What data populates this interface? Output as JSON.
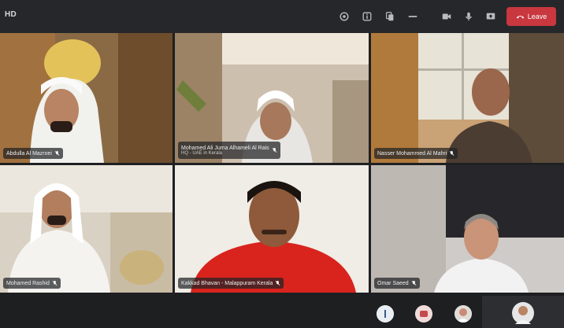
{
  "app": {
    "title": "HD"
  },
  "toolbar": {
    "icons": [
      "settings-icon",
      "info-icon",
      "copy-icon",
      "more-icon",
      "video-icon",
      "mic-icon",
      "screen-share-icon"
    ],
    "leave_label": "Leave"
  },
  "participants": [
    {
      "name": "Abdulla Al Mazroei",
      "muted": true
    },
    {
      "name": "Mohamed Ali Juma Alhameli Al Rais",
      "subtitle": "HQ - UAE in Kerala",
      "muted": true
    },
    {
      "name": "Nasser Mohammed Al Mahri",
      "muted": true
    },
    {
      "name": "Mohamed Rashid",
      "muted": true
    },
    {
      "name": "Kakkad Bhavan - Malappuram Kerala",
      "muted": true
    },
    {
      "name": "Omar Saeed",
      "muted": true
    }
  ],
  "colors": {
    "leave": "#c9373f",
    "topbar": "#26272a",
    "background": "#1f2022"
  }
}
